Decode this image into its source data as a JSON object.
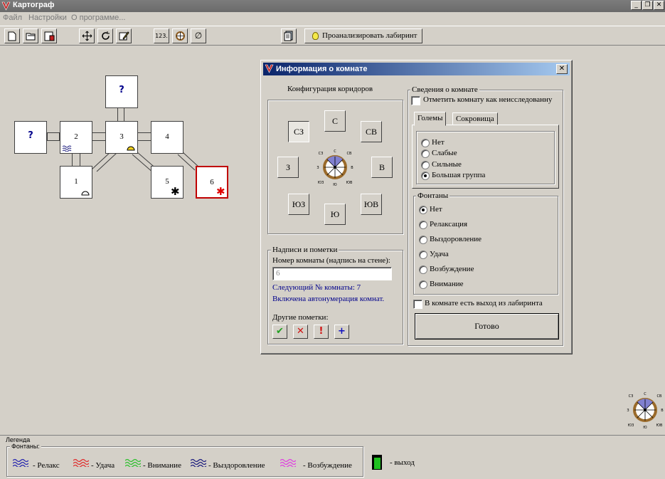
{
  "window": {
    "title": "Картограф"
  },
  "menu": [
    "Файл",
    "Настройки",
    "О программе..."
  ],
  "toolbar": {
    "number_label": "123.",
    "analyze_label": "Проанализировать лабиринт"
  },
  "maze": {
    "rooms": [
      {
        "id": "q-top",
        "label": "?",
        "unknown": true
      },
      {
        "id": "q-left",
        "label": "?",
        "unknown": true
      },
      {
        "id": "r2",
        "label": "2",
        "mark": "relax-fountain"
      },
      {
        "id": "r3",
        "label": "3",
        "mark": "fountain-yellow"
      },
      {
        "id": "r4",
        "label": "4"
      },
      {
        "id": "r1",
        "label": "1",
        "mark": "fountain-empty"
      },
      {
        "id": "r5",
        "label": "5",
        "mark": "golem-black"
      },
      {
        "id": "r6",
        "label": "6",
        "mark": "golem-red",
        "selected": true
      }
    ]
  },
  "dialog": {
    "title": "Информация о комнате",
    "corridors": {
      "label": "Конфигурация коридоров",
      "buttons": {
        "nw": "СЗ",
        "n": "С",
        "ne": "СВ",
        "w": "З",
        "e": "В",
        "sw": "ЮЗ",
        "s": "Ю",
        "se": "ЮВ"
      },
      "pressed": "nw",
      "compass": {
        "n": "С",
        "s": "Ю",
        "w": "З",
        "e": "В",
        "nw": "СЗ",
        "ne": "СВ",
        "sw": "ЮЗ",
        "se": "ЮВ"
      }
    },
    "notes": {
      "label": "Надписи и пометки",
      "room_number_label": "Номер комнаты (надпись на стене):",
      "room_number_value": "6",
      "next_room_text": "Следующий № комнаты: 7",
      "autonumber_text": "Включена автонумерация комнат.",
      "other_marks_label": "Другие пометки:"
    },
    "room_info": {
      "label": "Сведения о комнате",
      "unexplored_label": "Отметить комнату как неисследованну",
      "tabs": [
        "Големы",
        "Сокровища"
      ],
      "golems": [
        "Нет",
        "Слабые",
        "Сильные",
        "Большая группа"
      ],
      "golems_selected": 3,
      "fountains_label": "Фонтаны",
      "fountains": [
        "Нет",
        "Релаксация",
        "Выздоровление",
        "Удача",
        "Возбуждение",
        "Внимание"
      ],
      "fountains_selected": 0,
      "exit_label": "В комнате есть выход из лабиринта",
      "done_label": "Готово"
    }
  },
  "legend": {
    "title": "Легенда",
    "fountains_label": "Фонтаны:",
    "items": [
      {
        "label": "- Релакс",
        "color": "#2a2ab0"
      },
      {
        "label": "- Удача",
        "color": "#e03030"
      },
      {
        "label": "- Внимание",
        "color": "#30c030"
      },
      {
        "label": "- Выздоровление",
        "color": "#202080"
      },
      {
        "label": "- Возбуждение",
        "color": "#e040e0"
      }
    ],
    "exit_label": "- выход"
  },
  "colors": {
    "selected_room": "#c00000",
    "dialog_title": "#0a246a",
    "info_text": "#00008b"
  }
}
